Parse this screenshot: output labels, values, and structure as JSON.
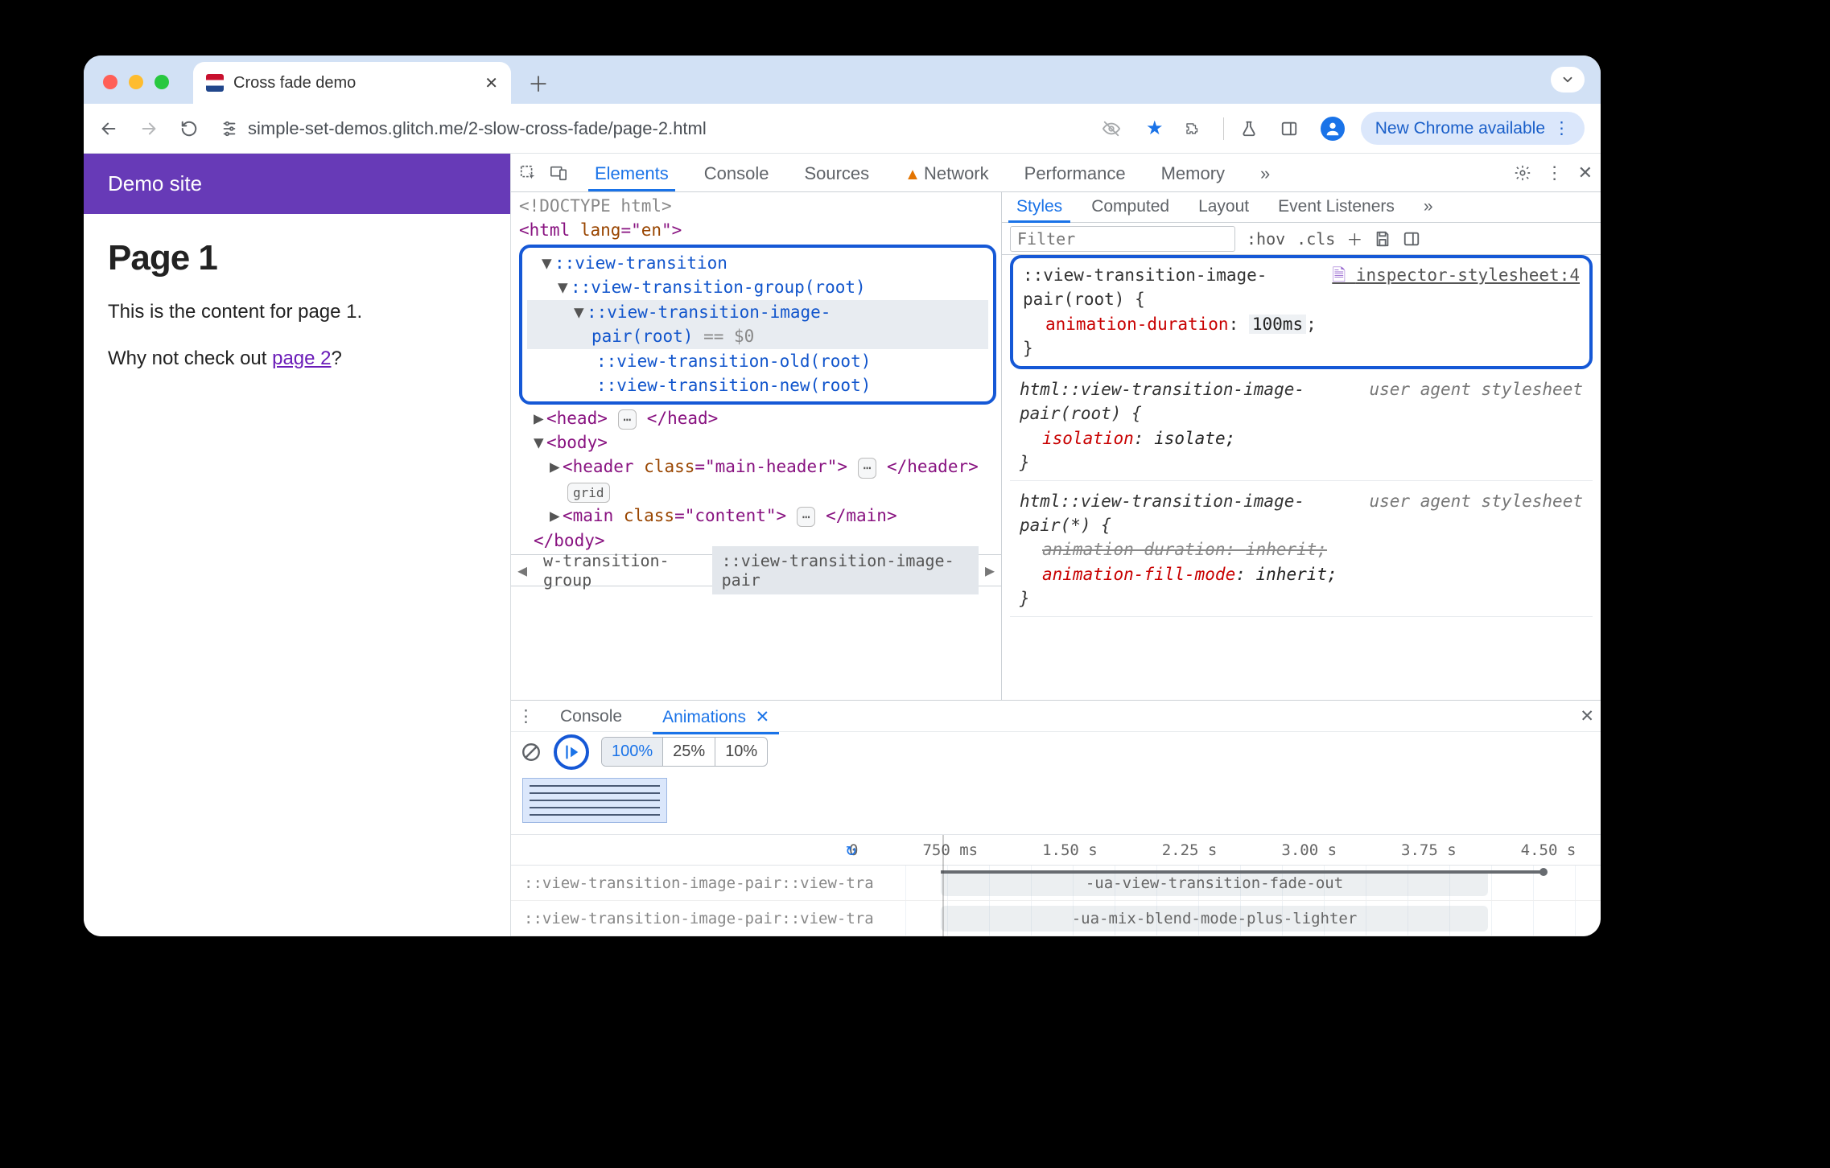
{
  "browser": {
    "tab_title": "Cross fade demo",
    "url": "simple-set-demos.glitch.me/2-slow-cross-fade/page-2.html",
    "update_label": "New Chrome available"
  },
  "page": {
    "site_header": "Demo site",
    "heading": "Page 1",
    "paragraph1": "This is the content for page 1.",
    "paragraph2_prefix": "Why not check out ",
    "link_text": "page 2",
    "paragraph2_suffix": "?"
  },
  "devtools": {
    "tabs": {
      "elements": "Elements",
      "console": "Console",
      "sources": "Sources",
      "network": "Network",
      "performance": "Performance",
      "memory": "Memory"
    },
    "dom": {
      "doctype": "<!DOCTYPE html>",
      "html_open": "<html lang=\"en\">",
      "vt": "::view-transition",
      "vt_group": "::view-transition-group(root)",
      "vt_pair_a": "::view-transition-image-",
      "vt_pair_b": "pair(root)",
      "eq_zero": " == $0",
      "vt_old": "::view-transition-old(root)",
      "vt_new": "::view-transition-new(root)",
      "head_open": "<head>",
      "head_close": " </head>",
      "body_open": "<body>",
      "header_open": "<header class=\"main-header\">",
      "header_close": " </header>",
      "grid_badge": "grid",
      "main_open": "<main class=\"content\">",
      "main_close": " </main>",
      "body_close": "</body>"
    },
    "breadcrumb": {
      "group": "w-transition-group",
      "pair": "::view-transition-image-pair"
    },
    "styles": {
      "tabs": {
        "styles": "Styles",
        "computed": "Computed",
        "layout": "Layout",
        "events": "Event Listeners"
      },
      "filter_placeholder": "Filter",
      "hov": ":hov",
      "cls": ".cls",
      "rule1": {
        "selector": "::view-transition-image-pair(root) {",
        "source": "inspector-stylesheet:4",
        "prop": "animation-duration",
        "val": "100ms",
        "close": "}"
      },
      "rule2": {
        "selector": "html::view-transition-image-pair(root) {",
        "source": "user agent stylesheet",
        "prop": "isolation",
        "val": "isolate;",
        "close": "}"
      },
      "rule3": {
        "selector": "html::view-transition-image-pair(*) {",
        "source": "user agent stylesheet",
        "p1": "animation-duration",
        "v1": "inherit;",
        "p2": "animation-fill-mode",
        "v2": "inherit;",
        "close": "}"
      }
    },
    "drawer": {
      "tabs": {
        "console": "Console",
        "animations": "Animations"
      },
      "speeds": {
        "s100": "100%",
        "s25": "25%",
        "s10": "10%"
      },
      "ticks": {
        "t0": "0",
        "t1": "750 ms",
        "t2": "1.50 s",
        "t3": "2.25 s",
        "t4": "3.00 s",
        "t5": "3.75 s",
        "t6": "4.50 s"
      },
      "tracks": {
        "label": "::view-transition-image-pair::view-tra",
        "name1": "-ua-view-transition-fade-out",
        "name2": "-ua-mix-blend-mode-plus-lighter"
      }
    }
  }
}
